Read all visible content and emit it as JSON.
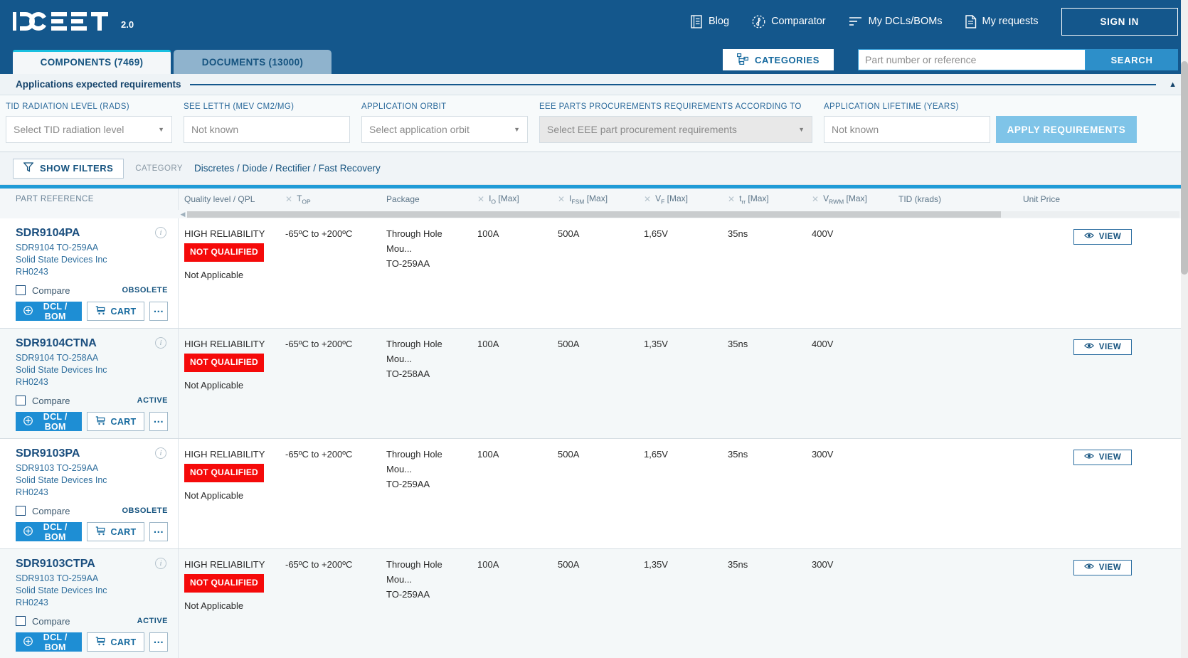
{
  "header": {
    "logo_text": "DOEEET",
    "logo_version": "2.0",
    "nav": [
      {
        "label": "Blog",
        "icon": "blog-icon"
      },
      {
        "label": "Comparator",
        "icon": "comparator-icon"
      },
      {
        "label": "My DCLs/BOMs",
        "icon": "list-icon"
      },
      {
        "label": "My requests",
        "icon": "document-icon"
      }
    ],
    "sign_in": "SIGN IN"
  },
  "tabs": [
    {
      "label": "COMPONENTS (7469)",
      "active": true
    },
    {
      "label": "DOCUMENTS (13000)",
      "active": false
    }
  ],
  "search": {
    "categories_label": "CATEGORIES",
    "placeholder": "Part number or reference",
    "value": "",
    "search_label": "SEARCH"
  },
  "requirements": {
    "title": "Applications expected requirements",
    "collapse_icon": "chevron-up-icon",
    "fields": [
      {
        "label": "TID RADIATION LEVEL (RADS)",
        "value": "Select TID radiation level",
        "type": "select",
        "disabled": false
      },
      {
        "label": "SEE LETTH (MEV CM2/MG)",
        "value": "Not known",
        "type": "text",
        "disabled": false
      },
      {
        "label": "APPLICATION ORBIT",
        "value": "Select application orbit",
        "type": "select",
        "disabled": false
      },
      {
        "label": "EEE PARTS PROCUREMENTS REQUIREMENTS ACCORDING TO",
        "value": "Select EEE part procurement requirements",
        "type": "select",
        "disabled": true
      },
      {
        "label": "APPLICATION LIFETIME (YEARS)",
        "value": "Not known",
        "type": "text",
        "disabled": false
      }
    ],
    "apply_label": "APPLY REQUIREMENTS"
  },
  "filterbar": {
    "show_filters": "SHOW FILTERS",
    "category_label": "CATEGORY",
    "breadcrumb": "Discretes / Diode / Rectifier / Fast Recovery"
  },
  "table": {
    "columns": [
      {
        "label": "PART REFERENCE",
        "removable": false
      },
      {
        "label": "Quality level / QPL",
        "removable": false
      },
      {
        "label": "T",
        "sub": "OP",
        "removable": true
      },
      {
        "label": "Package",
        "removable": false
      },
      {
        "label": "I",
        "sub": "O",
        "suffix": " [Max]",
        "removable": true
      },
      {
        "label": "I",
        "sub": "FSM",
        "suffix": " [Max]",
        "removable": true
      },
      {
        "label": "V",
        "sub": "F",
        "suffix": " [Max]",
        "removable": true
      },
      {
        "label": "t",
        "sub": "rr",
        "suffix": " [Max]",
        "removable": true
      },
      {
        "label": "V",
        "sub": "RWM",
        "suffix": " [Max]",
        "removable": true
      },
      {
        "label": "TID (krads)",
        "removable": false
      },
      {
        "label": "Unit Price",
        "removable": false
      }
    ],
    "rows": [
      {
        "part_number": "SDR9104PA",
        "line2": "SDR9104 TO-259AA",
        "manufacturer": "Solid State Devices Inc",
        "code": "RH0243",
        "compare_label": "Compare",
        "status": "OBSOLETE",
        "dcl_label": "DCL / BOM",
        "cart_label": "CART",
        "quality_level": "HIGH RELIABILITY",
        "qpl_badge": "NOT QUALIFIED",
        "qpl_note": "Not Applicable",
        "top": "-65ºC to +200ºC",
        "package": "Through Hole Mou...",
        "package2": "TO-259AA",
        "io_max": "100A",
        "ifsm_max": "500A",
        "vf_max": "1,65V",
        "trr_max": "35ns",
        "vrwm_max": "400V",
        "tid": "",
        "unit_price": "VIEW"
      },
      {
        "part_number": "SDR9104CTNA",
        "line2": "SDR9104 TO-258AA",
        "manufacturer": "Solid State Devices Inc",
        "code": "RH0243",
        "compare_label": "Compare",
        "status": "ACTIVE",
        "dcl_label": "DCL / BOM",
        "cart_label": "CART",
        "quality_level": "HIGH RELIABILITY",
        "qpl_badge": "NOT QUALIFIED",
        "qpl_note": "Not Applicable",
        "top": "-65ºC to +200ºC",
        "package": "Through Hole Mou...",
        "package2": "TO-258AA",
        "io_max": "100A",
        "ifsm_max": "500A",
        "vf_max": "1,35V",
        "trr_max": "35ns",
        "vrwm_max": "400V",
        "tid": "",
        "unit_price": "VIEW"
      },
      {
        "part_number": "SDR9103PA",
        "line2": "SDR9103 TO-259AA",
        "manufacturer": "Solid State Devices Inc",
        "code": "RH0243",
        "compare_label": "Compare",
        "status": "OBSOLETE",
        "dcl_label": "DCL / BOM",
        "cart_label": "CART",
        "quality_level": "HIGH RELIABILITY",
        "qpl_badge": "NOT QUALIFIED",
        "qpl_note": "Not Applicable",
        "top": "-65ºC to +200ºC",
        "package": "Through Hole Mou...",
        "package2": "TO-259AA",
        "io_max": "100A",
        "ifsm_max": "500A",
        "vf_max": "1,65V",
        "trr_max": "35ns",
        "vrwm_max": "300V",
        "tid": "",
        "unit_price": "VIEW"
      },
      {
        "part_number": "SDR9103CTPA",
        "line2": "SDR9103 TO-259AA",
        "manufacturer": "Solid State Devices Inc",
        "code": "RH0243",
        "compare_label": "Compare",
        "status": "ACTIVE",
        "dcl_label": "DCL / BOM",
        "cart_label": "CART",
        "quality_level": "HIGH RELIABILITY",
        "qpl_badge": "NOT QUALIFIED",
        "qpl_note": "Not Applicable",
        "top": "-65ºC to +200ºC",
        "package": "Through Hole Mou...",
        "package2": "TO-259AA",
        "io_max": "100A",
        "ifsm_max": "500A",
        "vf_max": "1,35V",
        "trr_max": "35ns",
        "vrwm_max": "300V",
        "tid": "",
        "unit_price": "VIEW"
      }
    ]
  },
  "colors": {
    "brand_blue": "#14578c",
    "accent_cyan": "#19c0e0",
    "button_blue": "#1e8ed4",
    "danger_red": "#f50a0a",
    "apply_light": "#7fc4e8"
  }
}
